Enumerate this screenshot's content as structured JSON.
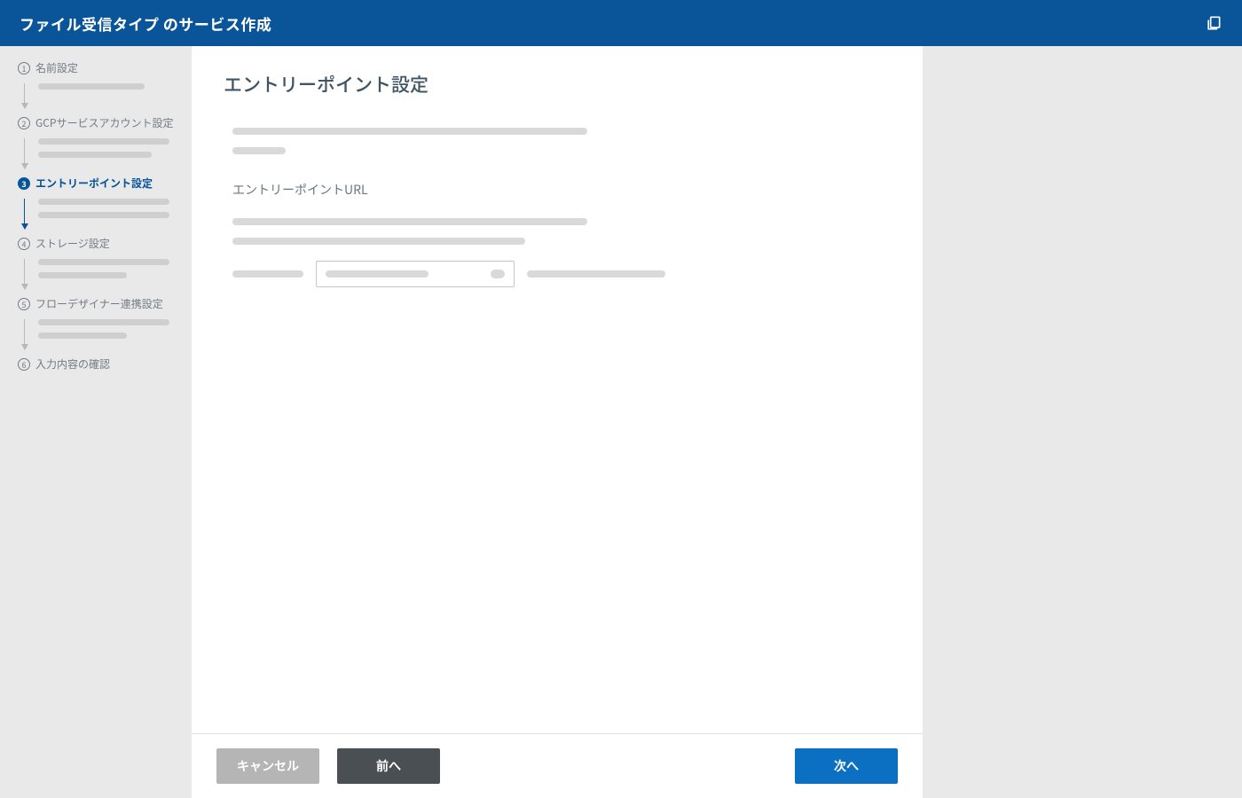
{
  "header": {
    "title": "ファイル受信タイプ のサービス作成",
    "action_icon": "copy-stack-icon"
  },
  "stepper": {
    "steps": [
      {
        "num": "1",
        "label": "名前設定",
        "active": false,
        "placeholders": 1
      },
      {
        "num": "2",
        "label": "GCPサービスアカウント設定",
        "active": false,
        "placeholders": 2
      },
      {
        "num": "3",
        "label": "エントリーポイント設定",
        "active": true,
        "placeholders": 2
      },
      {
        "num": "4",
        "label": "ストレージ設定",
        "active": false,
        "placeholders": 2
      },
      {
        "num": "5",
        "label": "フローデザイナー連携設定",
        "active": false,
        "placeholders": 2
      },
      {
        "num": "6",
        "label": "入力内容の確認",
        "active": false,
        "placeholders": 0
      }
    ]
  },
  "main": {
    "page_title": "エントリーポイント設定",
    "intro_placeholders": [
      400,
      60
    ],
    "section_label": "エントリーポイントURL",
    "url_placeholders": [
      400,
      330
    ],
    "url_row": {
      "prefix_width": 80,
      "input_bar_width": 116,
      "suffix_width": 156
    }
  },
  "footer": {
    "cancel": "キャンセル",
    "back": "前へ",
    "next": "次へ"
  }
}
